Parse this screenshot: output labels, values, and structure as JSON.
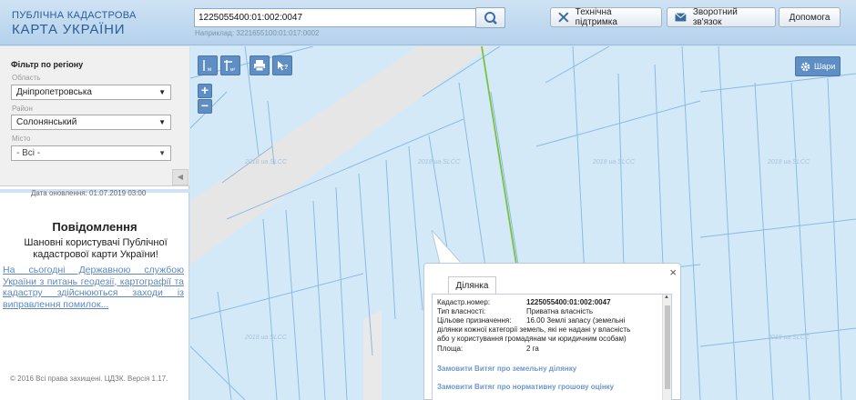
{
  "header": {
    "brand_line1": "ПУБЛІЧНА КАДАСТРОВА",
    "brand_line2": "КАРТА УКРАЇНИ",
    "search_value": "1225055400:01:002:0047",
    "search_hint": "Наприклад: 3221655100:01:017:0002",
    "buttons": {
      "support": "Технічна підтримка",
      "feedback": "Зворотний зв'язок",
      "help": "Допомога"
    }
  },
  "sidebar": {
    "filter_title": "Фільтр по регіону",
    "oblast_label": "Область",
    "oblast_value": "Дніпропетровська",
    "raion_label": "Район",
    "raion_value": "Солонянський",
    "city_label": "Місто",
    "city_value": "- Всі -",
    "updated": "Дата оновлення: 01.07.2019 03:00",
    "notice_title": "Повідомлення",
    "notice_text": "Шановні користувачі Публічної кадастрової карти України!",
    "notice_link": "На сьогодні Державною службою України з питань геодезії, картографії та кадастру здійснюються заходи із виправлення помилок...",
    "copyright": "© 2016 Всі права захищені. ЦДЗК. Версія 1.17."
  },
  "map": {
    "watermark": "2018 ua SLCC",
    "layers_label": "Шари",
    "tools": [
      "ruler-m-icon",
      "ruler-m2-icon",
      "print-icon",
      "help-pointer-icon"
    ],
    "zoom_in": "+",
    "zoom_out": "−"
  },
  "popup": {
    "close": "×",
    "tab": "Ділянка",
    "fields": {
      "cadnum_label": "Кадастр.номер:",
      "cadnum_value": "1225055400:01:002:0047",
      "ownership_label": "Тип власності:",
      "ownership_value": "Приватна власність",
      "purpose_label": "Цільове призначення:",
      "purpose_line1": "16.00 Землі запасу (земельні",
      "purpose_line2": "ділянки кожної категорії земель, які не надані у власність",
      "purpose_line3": "або у користування громадянам чи юридичним особам)",
      "area_label": "Площа:",
      "area_value": "2 га"
    },
    "links": {
      "extract": "Замовити Витяг про земельну ділянку",
      "valuation": "Замовити Витяг про нормативну грошову оцінку"
    }
  },
  "colors": {
    "brand": "#2a5e95",
    "map_bg": "#d3e9f8",
    "parcel_line": "#8cb9e4",
    "boundary_green": "#7bc23f",
    "tool_blue": "#5f8ec4",
    "link": "#5d87c0"
  }
}
